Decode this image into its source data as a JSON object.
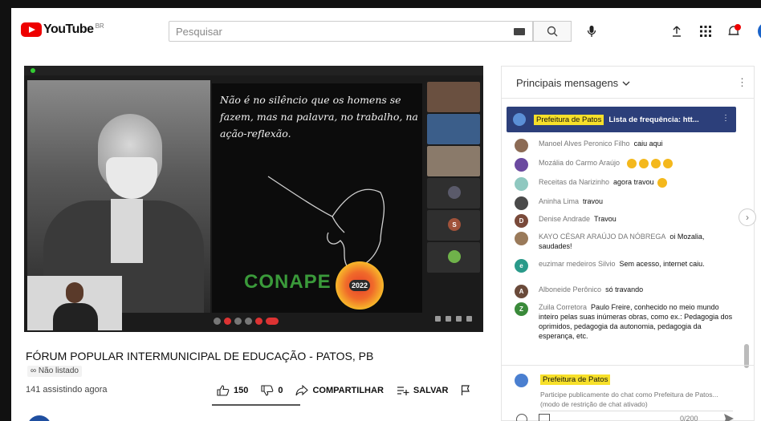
{
  "header": {
    "logo_text": "YouTube",
    "logo_region": "BR",
    "search_placeholder": "Pesquisar",
    "icons": [
      "keyboard-icon",
      "search-icon",
      "mic-icon",
      "upload-icon",
      "apps-icon",
      "notifications-icon"
    ],
    "notification_count": ""
  },
  "video": {
    "quote": "Não é no silêncio que os homens se fazem, mas na palavra, no trabalho, na ação-reflexão.",
    "brand": "CONAPE",
    "brand_year": "2022",
    "tiles": [
      {
        "initial": "",
        "color": "#6a5040"
      },
      {
        "initial": "",
        "color": "#3b5e8a"
      },
      {
        "initial": "",
        "color": "#8a7a6a"
      },
      {
        "initial": "",
        "color": "#5a5a6a"
      },
      {
        "initial": "S",
        "color": "#a0523a"
      },
      {
        "initial": "",
        "color": "#6fb24a"
      }
    ]
  },
  "info": {
    "title": "FÓRUM POPULAR INTERMUNICIPAL DE EDUCAÇÃO - PATOS, PB",
    "unlisted": "Não listado",
    "views": "141 assistindo agora",
    "likes": "150",
    "dislikes": "0",
    "share": "COMPARTILHAR",
    "save": "SALVAR"
  },
  "chat": {
    "title": "Principais mensagens",
    "pinned_author": "Prefeitura de Patos",
    "pinned_text": "Lista de frequência: htt...",
    "messages": [
      {
        "author": "Manoel Alves Peronico Filho",
        "text": "caiu aqui",
        "color": "#8c6b55",
        "initial": ""
      },
      {
        "author": "Mozália do Carmo Araújo",
        "text": "",
        "emojis": 4,
        "color": "#6b4aa0",
        "initial": ""
      },
      {
        "author": "Receitas da Narizinho",
        "text": "agora travou",
        "emojis": 1,
        "color": "#8fc8c0",
        "initial": ""
      },
      {
        "author": "Aninha Lima",
        "text": "travou",
        "color": "#4a4a4a",
        "initial": ""
      },
      {
        "author": "Denise Andrade",
        "text": "Travou",
        "color": "#7a4a3a",
        "initial": "D"
      },
      {
        "author": "KAYO CÉSAR ARAÚJO DA NÓBREGA",
        "text": "oi Mozalia, saudades!",
        "color": "#9a7a5a",
        "initial": ""
      },
      {
        "author": "euzimar medeiros Silvio",
        "text": "Sem acesso, internet caiu.",
        "color": "#2a9a8a",
        "initial": "e"
      },
      {
        "author": "Alboneide Perônico",
        "text": "só travando",
        "color": "#6a4a3a",
        "initial": "A"
      },
      {
        "author": "Zuila Corretora",
        "text": "Paulo Freire, conhecido no meio mundo inteiro pelas suas inúmeras obras, como ex.: Pedagogia dos oprimidos, pedagogia da autonomia, pedagogia da esperança, etc.",
        "color": "#3a8a3a",
        "initial": "Z"
      }
    ],
    "composer_author": "Prefeitura de Patos",
    "composer_placeholder": "Participe publicamente do chat como Prefeitura de Patos... (modo de restrição de chat ativado)",
    "char_count": "0/200"
  }
}
